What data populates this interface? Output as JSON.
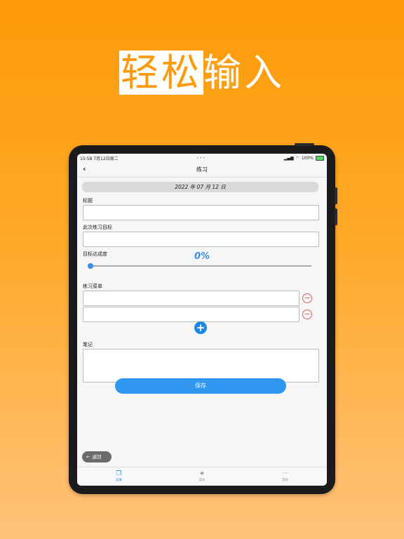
{
  "headline": {
    "highlight": "轻松",
    "rest": "输入"
  },
  "status_bar": {
    "time": "15:58",
    "date": "7月12日周二",
    "battery": "100%"
  },
  "nav": {
    "back_symbol": "‹",
    "title": "练习"
  },
  "date_bar": {
    "text": "2022 年 07 月 12 日"
  },
  "form": {
    "title_label": "标题",
    "title_value": "",
    "goal_label": "此次练习目标",
    "goal_value": "",
    "progress_label": "目标达成度",
    "progress_text": "0%",
    "progress_value": 0,
    "menu_label": "练习菜单",
    "menu_items": [
      "",
      ""
    ],
    "notes_label": "笔记",
    "notes_value": ""
  },
  "buttons": {
    "save": "保存",
    "return": "返回",
    "minus_symbol": "−",
    "plus_symbol": "+"
  },
  "tabs": [
    {
      "label": "记录",
      "icon": "records-icon",
      "glyph": "❐",
      "active": true
    },
    {
      "label": "成长",
      "icon": "star-icon",
      "glyph": "★",
      "active": false
    },
    {
      "label": "其他",
      "icon": "more-icon",
      "glyph": "···",
      "active": false
    }
  ],
  "colors": {
    "accent": "#2f97f0",
    "background": "#ff9a0a",
    "danger": "#e06060"
  }
}
